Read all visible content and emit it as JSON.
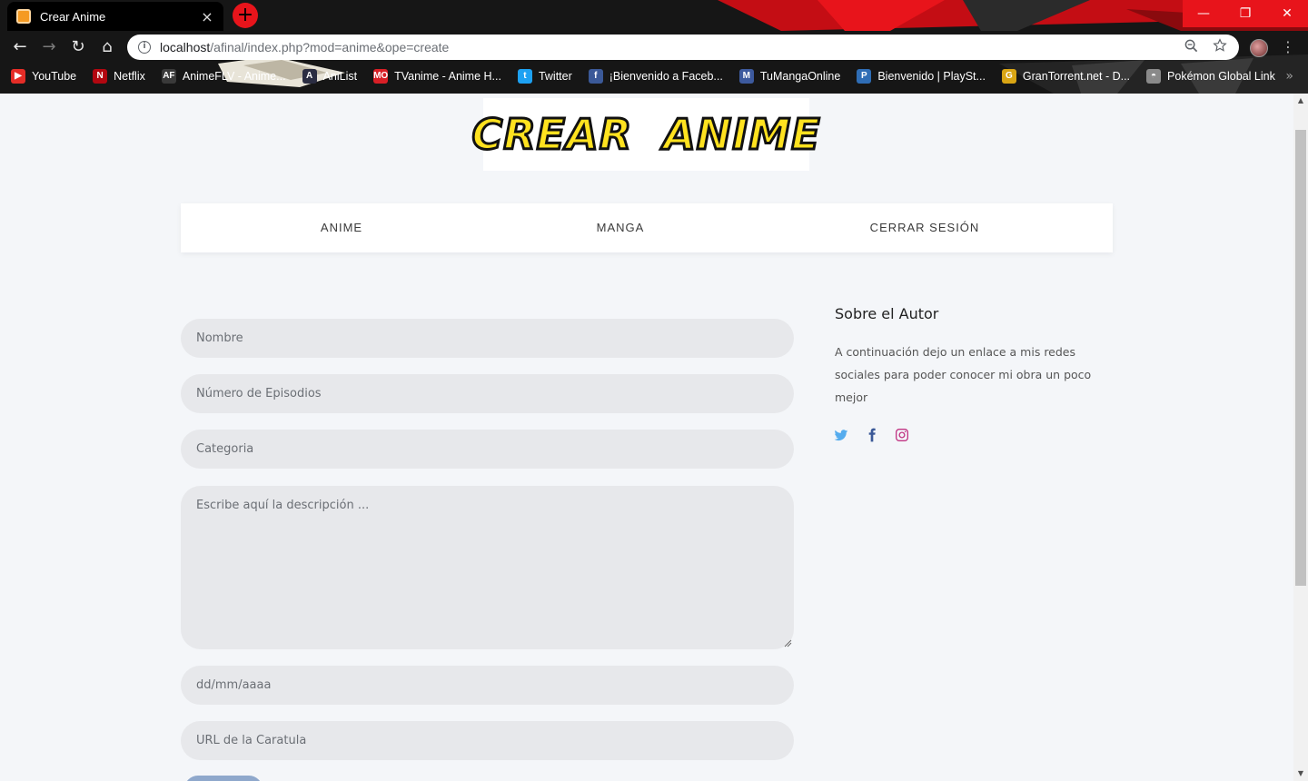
{
  "browser": {
    "tab_title": "Crear Anime",
    "tab_close": "×",
    "new_tab": "+",
    "window_buttons": [
      "—",
      "❐",
      "✕"
    ],
    "url_host": "localhost",
    "url_path": "/afinal/index.php?mod=anime&ope=create",
    "nav": {
      "back": "←",
      "forward": "→",
      "reload": "↻",
      "home": "⌂"
    },
    "more": "⋮",
    "bookmarks": [
      {
        "label": "YouTube",
        "icon": "youtube-icon",
        "glyph": "▶",
        "color": "#e52d27"
      },
      {
        "label": "Netflix",
        "icon": "netflix-icon",
        "glyph": "N",
        "color": "#b20710"
      },
      {
        "label": "AnimeFLV - Anime...",
        "icon": "animeflv-icon",
        "glyph": "AF",
        "color": "#3a3a3a"
      },
      {
        "label": "AniList",
        "icon": "anilist-icon",
        "glyph": "A",
        "color": "#2b2d42"
      },
      {
        "label": "TVanime - Anime H...",
        "icon": "tvanime-icon",
        "glyph": "MO",
        "color": "#d81f26"
      },
      {
        "label": "Twitter",
        "icon": "twitter-icon",
        "glyph": "t",
        "color": "#1da1f2"
      },
      {
        "label": "¡Bienvenido a Faceb...",
        "icon": "facebook-icon",
        "glyph": "f",
        "color": "#3b5998"
      },
      {
        "label": "TuMangaOnline",
        "icon": "tumangaonline-icon",
        "glyph": "M",
        "color": "#3d5a9e"
      },
      {
        "label": "Bienvenido | PlaySt...",
        "icon": "playstation-icon",
        "glyph": "P",
        "color": "#2f6db5"
      },
      {
        "label": "GranTorrent.net - D...",
        "icon": "grantorrent-icon",
        "glyph": "G",
        "color": "#d9a514"
      },
      {
        "label": "Pokémon Global Link",
        "icon": "pokemon-icon",
        "glyph": "◓",
        "color": "#8a8a8a"
      }
    ],
    "bookmarks_more": "»"
  },
  "header": {
    "logo_word1": "CREAR",
    "logo_word2": "ANIME"
  },
  "nav": {
    "items": [
      "ANIME",
      "MANGA",
      "CERRAR SESIÓN"
    ]
  },
  "form": {
    "nombre_placeholder": "Nombre",
    "episodios_placeholder": "Número de Episodios",
    "categoria_placeholder": "Categoria",
    "descripcion_placeholder": "Escribe aquí la descripción ...",
    "fecha_placeholder": "dd/mm/aaaa",
    "caratula_placeholder": "URL de la Caratula"
  },
  "sidebar": {
    "title": "Sobre el Autor",
    "text": "A continuación dejo un enlace a mis redes sociales para poder conocer mi obra un poco mejor",
    "social": [
      {
        "icon": "twitter-icon",
        "color": "#55acee"
      },
      {
        "icon": "facebook-icon",
        "color": "#3b5998"
      },
      {
        "icon": "instagram-icon",
        "color": "#c13584"
      }
    ]
  },
  "colors": {
    "accent_red": "#e8141b",
    "page_bg": "#f4f6f9",
    "field_bg": "#e7e8eb",
    "button_blue": "#8fa8cc"
  }
}
